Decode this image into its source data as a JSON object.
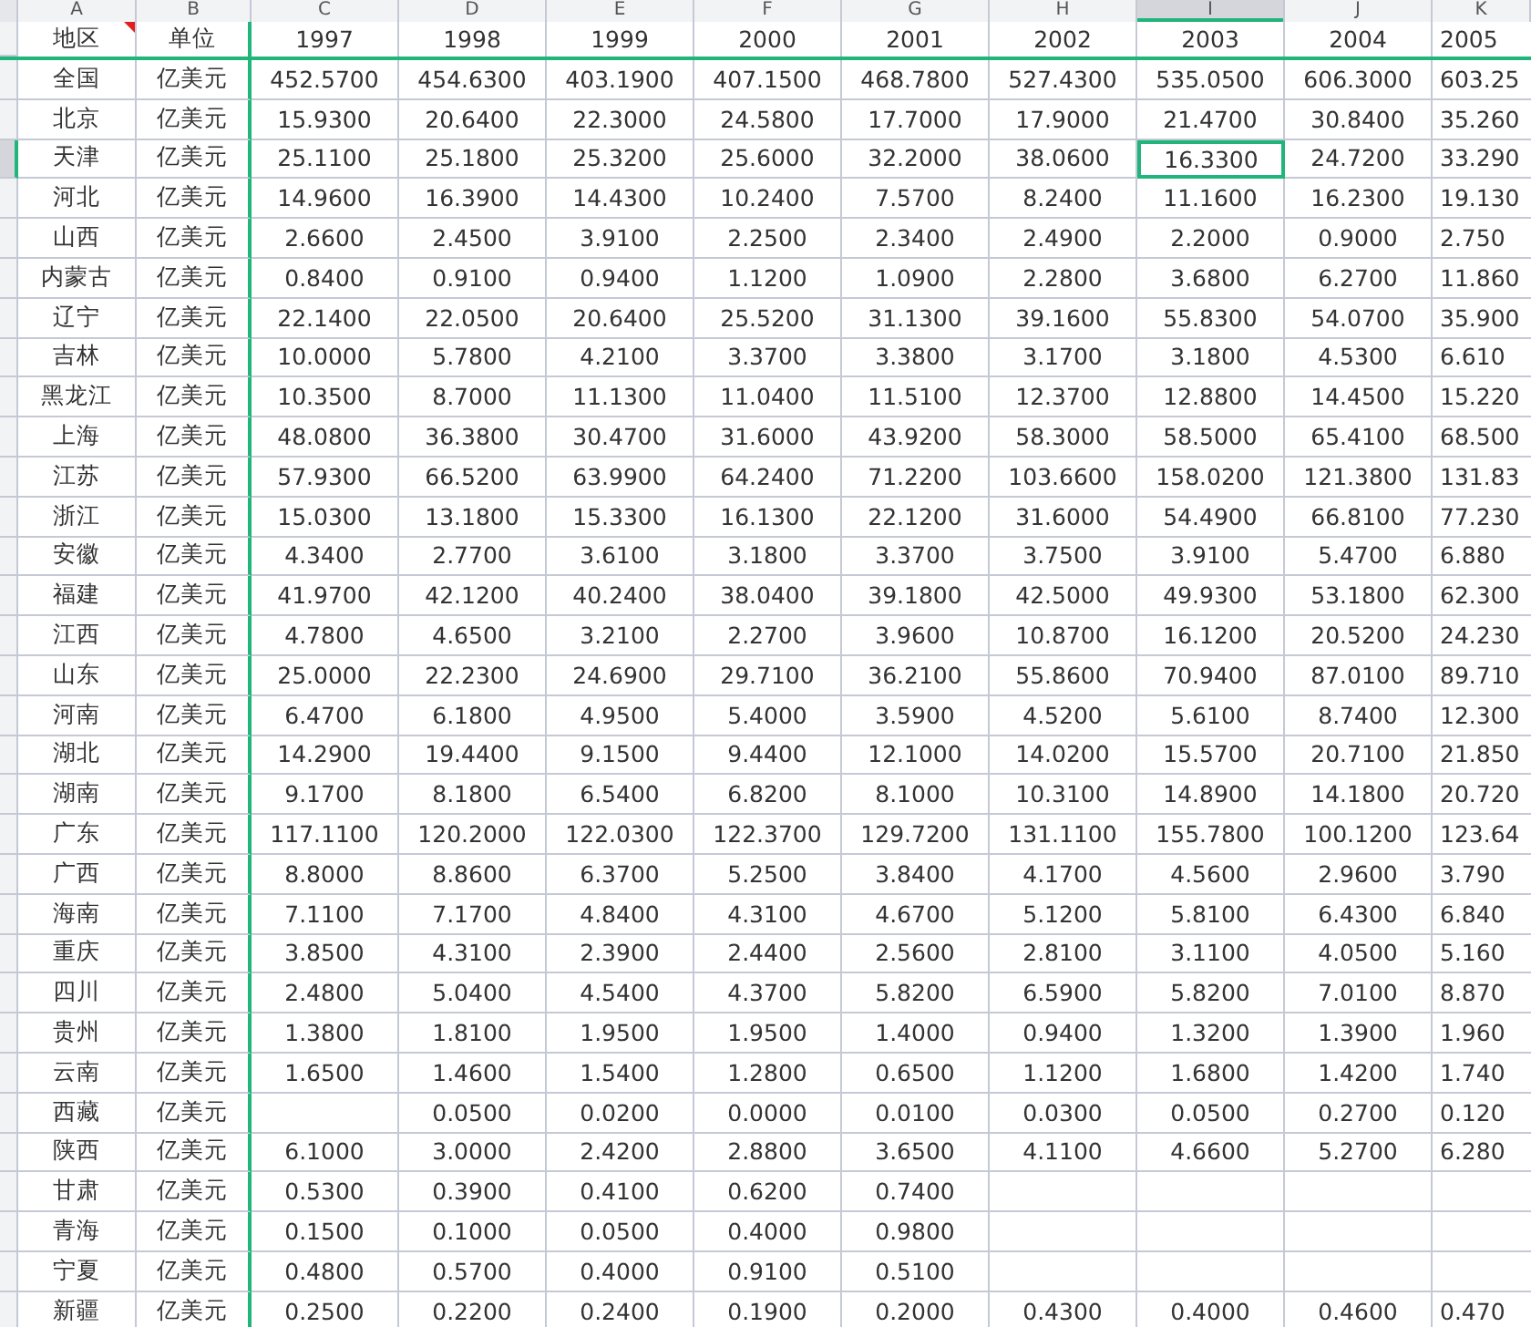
{
  "columns": [
    {
      "letter": "A",
      "selected": false
    },
    {
      "letter": "B",
      "selected": false
    },
    {
      "letter": "C",
      "selected": false
    },
    {
      "letter": "D",
      "selected": false
    },
    {
      "letter": "E",
      "selected": false
    },
    {
      "letter": "F",
      "selected": false
    },
    {
      "letter": "G",
      "selected": false
    },
    {
      "letter": "H",
      "selected": false
    },
    {
      "letter": "I",
      "selected": true
    },
    {
      "letter": "J",
      "selected": false
    },
    {
      "letter": "K",
      "selected": false
    }
  ],
  "header": [
    {
      "text": "地区",
      "comment": true
    },
    {
      "text": "单位",
      "comment": false
    },
    {
      "text": "1997",
      "comment": false
    },
    {
      "text": "1998",
      "comment": false
    },
    {
      "text": "1999",
      "comment": false
    },
    {
      "text": "2000",
      "comment": false
    },
    {
      "text": "2001",
      "comment": false
    },
    {
      "text": "2002",
      "comment": false
    },
    {
      "text": "2003",
      "comment": false
    },
    {
      "text": "2004",
      "comment": false
    },
    {
      "text": "2005",
      "comment": false
    }
  ],
  "rows": [
    {
      "selected": false,
      "cells": [
        "全国",
        "亿美元",
        "452.5700",
        "454.6300",
        "403.1900",
        "407.1500",
        "468.7800",
        "527.4300",
        "535.0500",
        "606.3000",
        "603.25"
      ]
    },
    {
      "selected": false,
      "cells": [
        "北京",
        "亿美元",
        "15.9300",
        "20.6400",
        "22.3000",
        "24.5800",
        "17.7000",
        "17.9000",
        "21.4700",
        "30.8400",
        "35.260"
      ]
    },
    {
      "selected": true,
      "cells": [
        "天津",
        "亿美元",
        "25.1100",
        "25.1800",
        "25.3200",
        "25.6000",
        "32.2000",
        "38.0600",
        "16.3300",
        "24.7200",
        "33.290"
      ]
    },
    {
      "selected": false,
      "cells": [
        "河北",
        "亿美元",
        "14.9600",
        "16.3900",
        "14.4300",
        "10.2400",
        "7.5700",
        "8.2400",
        "11.1600",
        "16.2300",
        "19.130"
      ]
    },
    {
      "selected": false,
      "cells": [
        "山西",
        "亿美元",
        "2.6600",
        "2.4500",
        "3.9100",
        "2.2500",
        "2.3400",
        "2.4900",
        "2.2000",
        "0.9000",
        "2.750"
      ]
    },
    {
      "selected": false,
      "cells": [
        "内蒙古",
        "亿美元",
        "0.8400",
        "0.9100",
        "0.9400",
        "1.1200",
        "1.0900",
        "2.2800",
        "3.6800",
        "6.2700",
        "11.860"
      ]
    },
    {
      "selected": false,
      "cells": [
        "辽宁",
        "亿美元",
        "22.1400",
        "22.0500",
        "20.6400",
        "25.5200",
        "31.1300",
        "39.1600",
        "55.8300",
        "54.0700",
        "35.900"
      ]
    },
    {
      "selected": false,
      "cells": [
        "吉林",
        "亿美元",
        "10.0000",
        "5.7800",
        "4.2100",
        "3.3700",
        "3.3800",
        "3.1700",
        "3.1800",
        "4.5300",
        "6.610"
      ]
    },
    {
      "selected": false,
      "cells": [
        "黑龙江",
        "亿美元",
        "10.3500",
        "8.7000",
        "11.1300",
        "11.0400",
        "11.5100",
        "12.3700",
        "12.8800",
        "14.4500",
        "15.220"
      ]
    },
    {
      "selected": false,
      "cells": [
        "上海",
        "亿美元",
        "48.0800",
        "36.3800",
        "30.4700",
        "31.6000",
        "43.9200",
        "58.3000",
        "58.5000",
        "65.4100",
        "68.500"
      ]
    },
    {
      "selected": false,
      "cells": [
        "江苏",
        "亿美元",
        "57.9300",
        "66.5200",
        "63.9900",
        "64.2400",
        "71.2200",
        "103.6600",
        "158.0200",
        "121.3800",
        "131.83"
      ]
    },
    {
      "selected": false,
      "cells": [
        "浙江",
        "亿美元",
        "15.0300",
        "13.1800",
        "15.3300",
        "16.1300",
        "22.1200",
        "31.6000",
        "54.4900",
        "66.8100",
        "77.230"
      ]
    },
    {
      "selected": false,
      "cells": [
        "安徽",
        "亿美元",
        "4.3400",
        "2.7700",
        "3.6100",
        "3.1800",
        "3.3700",
        "3.7500",
        "3.9100",
        "5.4700",
        "6.880"
      ]
    },
    {
      "selected": false,
      "cells": [
        "福建",
        "亿美元",
        "41.9700",
        "42.1200",
        "40.2400",
        "38.0400",
        "39.1800",
        "42.5000",
        "49.9300",
        "53.1800",
        "62.300"
      ]
    },
    {
      "selected": false,
      "cells": [
        "江西",
        "亿美元",
        "4.7800",
        "4.6500",
        "3.2100",
        "2.2700",
        "3.9600",
        "10.8700",
        "16.1200",
        "20.5200",
        "24.230"
      ]
    },
    {
      "selected": false,
      "cells": [
        "山东",
        "亿美元",
        "25.0000",
        "22.2300",
        "24.6900",
        "29.7100",
        "36.2100",
        "55.8600",
        "70.9400",
        "87.0100",
        "89.710"
      ]
    },
    {
      "selected": false,
      "cells": [
        "河南",
        "亿美元",
        "6.4700",
        "6.1800",
        "4.9500",
        "5.4000",
        "3.5900",
        "4.5200",
        "5.6100",
        "8.7400",
        "12.300"
      ]
    },
    {
      "selected": false,
      "cells": [
        "湖北",
        "亿美元",
        "14.2900",
        "19.4400",
        "9.1500",
        "9.4400",
        "12.1000",
        "14.0200",
        "15.5700",
        "20.7100",
        "21.850"
      ]
    },
    {
      "selected": false,
      "cells": [
        "湖南",
        "亿美元",
        "9.1700",
        "8.1800",
        "6.5400",
        "6.8200",
        "8.1000",
        "10.3100",
        "14.8900",
        "14.1800",
        "20.720"
      ]
    },
    {
      "selected": false,
      "cells": [
        "广东",
        "亿美元",
        "117.1100",
        "120.2000",
        "122.0300",
        "122.3700",
        "129.7200",
        "131.1100",
        "155.7800",
        "100.1200",
        "123.64"
      ]
    },
    {
      "selected": false,
      "cells": [
        "广西",
        "亿美元",
        "8.8000",
        "8.8600",
        "6.3700",
        "5.2500",
        "3.8400",
        "4.1700",
        "4.5600",
        "2.9600",
        "3.790"
      ]
    },
    {
      "selected": false,
      "cells": [
        "海南",
        "亿美元",
        "7.1100",
        "7.1700",
        "4.8400",
        "4.3100",
        "4.6700",
        "5.1200",
        "5.8100",
        "6.4300",
        "6.840"
      ]
    },
    {
      "selected": false,
      "cells": [
        "重庆",
        "亿美元",
        "3.8500",
        "4.3100",
        "2.3900",
        "2.4400",
        "2.5600",
        "2.8100",
        "3.1100",
        "4.0500",
        "5.160"
      ]
    },
    {
      "selected": false,
      "cells": [
        "四川",
        "亿美元",
        "2.4800",
        "5.0400",
        "4.5400",
        "4.3700",
        "5.8200",
        "6.5900",
        "5.8200",
        "7.0100",
        "8.870"
      ]
    },
    {
      "selected": false,
      "cells": [
        "贵州",
        "亿美元",
        "1.3800",
        "1.8100",
        "1.9500",
        "1.9500",
        "1.4000",
        "0.9400",
        "1.3200",
        "1.3900",
        "1.960"
      ]
    },
    {
      "selected": false,
      "cells": [
        "云南",
        "亿美元",
        "1.6500",
        "1.4600",
        "1.5400",
        "1.2800",
        "0.6500",
        "1.1200",
        "1.6800",
        "1.4200",
        "1.740"
      ]
    },
    {
      "selected": false,
      "cells": [
        "西藏",
        "亿美元",
        null,
        "0.0500",
        "0.0200",
        "0.0000",
        "0.0100",
        "0.0300",
        "0.0500",
        "0.2700",
        "0.120"
      ]
    },
    {
      "selected": false,
      "cells": [
        "陕西",
        "亿美元",
        "6.1000",
        "3.0000",
        "2.4200",
        "2.8800",
        "3.6500",
        "4.1100",
        "4.6600",
        "5.2700",
        "6.280"
      ]
    },
    {
      "selected": false,
      "cells": [
        "甘肃",
        "亿美元",
        "0.5300",
        "0.3900",
        "0.4100",
        "0.6200",
        "0.7400",
        null,
        null,
        null,
        null
      ]
    },
    {
      "selected": false,
      "cells": [
        "青海",
        "亿美元",
        "0.1500",
        "0.1000",
        "0.0500",
        "0.4000",
        "0.9800",
        null,
        null,
        null,
        null
      ]
    },
    {
      "selected": false,
      "cells": [
        "宁夏",
        "亿美元",
        "0.4800",
        "0.5700",
        "0.4000",
        "0.9100",
        "0.5100",
        null,
        null,
        null,
        null
      ]
    },
    {
      "selected": false,
      "cells": [
        "新疆",
        "亿美元",
        "0.2500",
        "0.2200",
        "0.2400",
        "0.1900",
        "0.2000",
        "0.4300",
        "0.4000",
        "0.4600",
        "0.470"
      ]
    }
  ]
}
